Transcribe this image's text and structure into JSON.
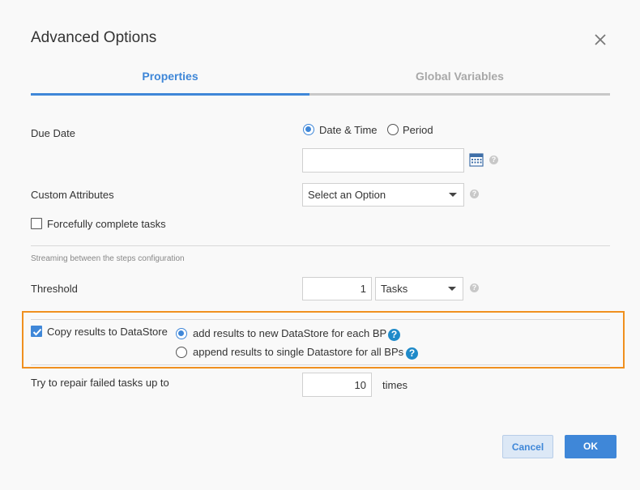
{
  "dialog": {
    "title": "Advanced Options"
  },
  "tabs": [
    {
      "label": "Properties",
      "active": true
    },
    {
      "label": "Global Variables",
      "active": false
    }
  ],
  "due_date": {
    "label": "Due Date",
    "options": [
      {
        "label": "Date & Time",
        "checked": true
      },
      {
        "label": "Period",
        "checked": false
      }
    ],
    "value": ""
  },
  "custom_attributes": {
    "label": "Custom Attributes",
    "selected": "Select an Option"
  },
  "forcefully_complete": {
    "label": "Forcefully complete tasks",
    "checked": false
  },
  "streaming": {
    "note": "Streaming between the steps configuration"
  },
  "threshold": {
    "label": "Threshold",
    "value": "1",
    "unit": "Tasks"
  },
  "copy_results": {
    "label": "Copy results to DataStore",
    "checked": true,
    "options": [
      {
        "label": "add results to new DataStore for each BP",
        "checked": true
      },
      {
        "label": "append results to single Datastore for all BPs",
        "checked": false
      }
    ]
  },
  "repair": {
    "label": "Try to repair failed tasks up to",
    "value": "10",
    "suffix": "times"
  },
  "buttons": {
    "cancel": "Cancel",
    "ok": "OK"
  },
  "colors": {
    "accent": "#3f87d8",
    "highlight": "#f0901f",
    "help_blue": "#1f8ac9"
  }
}
